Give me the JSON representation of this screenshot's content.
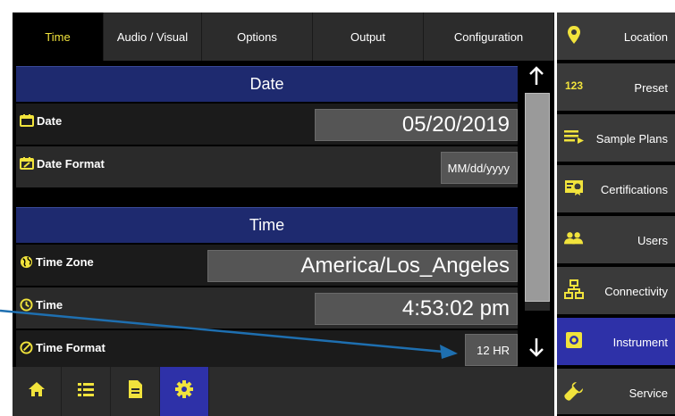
{
  "tabs": [
    {
      "label": "Time",
      "active": true
    },
    {
      "label": "Audio / Visual",
      "active": false
    },
    {
      "label": "Options",
      "active": false
    },
    {
      "label": "Output",
      "active": false
    },
    {
      "label": "Configuration",
      "active": false
    }
  ],
  "date_section": {
    "header": "Date",
    "date_label": "Date",
    "date_value": "05/20/2019",
    "format_label": "Date Format",
    "format_value": "MM/dd/yyyy"
  },
  "time_section": {
    "header": "Time",
    "zone_label": "Time Zone",
    "zone_value": "America/Los_Angeles",
    "time_label": "Time",
    "time_value": "4:53:02 pm",
    "format_label": "Time Format",
    "format_value": "12 HR"
  },
  "sidebar": {
    "items": [
      {
        "label": "Location",
        "icon": "map-pin-icon"
      },
      {
        "label": "Preset",
        "icon": "numbers-icon",
        "icon_text": "123"
      },
      {
        "label": "Sample Plans",
        "icon": "list-arrow-icon"
      },
      {
        "label": "Certifications",
        "icon": "certificate-icon"
      },
      {
        "label": "Users",
        "icon": "users-icon"
      },
      {
        "label": "Connectivity",
        "icon": "network-icon"
      },
      {
        "label": "Instrument",
        "icon": "instrument-gear-icon",
        "active": true
      },
      {
        "label": "Service",
        "icon": "wrench-icon"
      }
    ]
  },
  "bottom_bar": {
    "buttons": [
      {
        "icon": "home-icon"
      },
      {
        "icon": "list-icon"
      },
      {
        "icon": "document-icon"
      },
      {
        "icon": "settings-gear-icon",
        "active": true
      }
    ]
  },
  "colors": {
    "accent_yellow": "#f1e33c",
    "header_blue": "#1e2a6f",
    "active_blue": "#2e31a8",
    "annotation_arrow": "#1e6fb0"
  }
}
